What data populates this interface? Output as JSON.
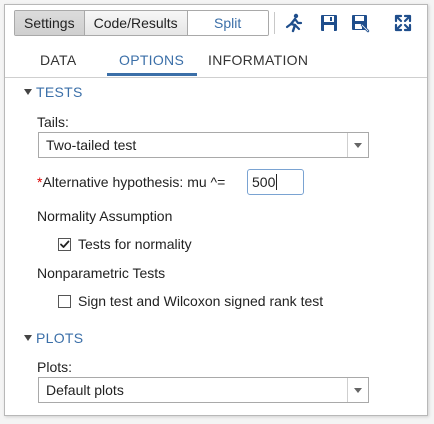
{
  "toolbar": {
    "segments": [
      {
        "label": "Settings",
        "state": "active"
      },
      {
        "label": "Code/Results",
        "state": "normal"
      },
      {
        "label": "Split",
        "state": "normal"
      }
    ],
    "icons": [
      "run-icon",
      "save-icon",
      "save-as-icon",
      "maximize-icon"
    ]
  },
  "tabs": [
    {
      "label": "DATA",
      "selected": false
    },
    {
      "label": "OPTIONS",
      "selected": true
    },
    {
      "label": "INFORMATION",
      "selected": false
    }
  ],
  "tests": {
    "section_title": "TESTS",
    "tails": {
      "label": "Tails:",
      "value": "Two-tailed test"
    },
    "alt_hypothesis": {
      "required_marker": "*",
      "label": "Alternative hypothesis: mu ^=",
      "value": "500"
    },
    "normality": {
      "group_label": "Normality Assumption",
      "checkbox_label": "Tests for normality",
      "checked": true
    },
    "nonparametric": {
      "group_label": "Nonparametric Tests",
      "checkbox_label": "Sign test and Wilcoxon signed rank test",
      "checked": false
    }
  },
  "plots": {
    "section_title": "PLOTS",
    "plots_select": {
      "label": "Plots:",
      "value": "Default plots"
    }
  },
  "colors": {
    "accent": "#3b6fa8",
    "required": "#dd0000",
    "border": "#a9a9a9"
  }
}
